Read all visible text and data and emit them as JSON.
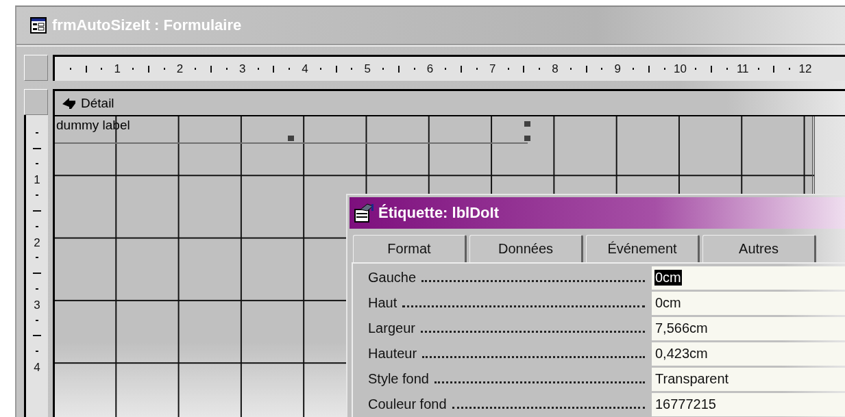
{
  "window": {
    "title": "frmAutoSizeIt : Formulaire"
  },
  "ruler_horizontal": [
    "1",
    "2",
    "3",
    "4",
    "5",
    "6",
    "7",
    "8",
    "9",
    "10",
    "11",
    "12"
  ],
  "ruler_vertical": [
    "1",
    "2",
    "3",
    "4"
  ],
  "section": {
    "title": "Détail"
  },
  "label_control": {
    "text": "dummy label",
    "selected": true
  },
  "property_sheet": {
    "title": "Étiquette: lblDoIt",
    "tabs": [
      {
        "label": "Format"
      },
      {
        "label": "Données"
      },
      {
        "label": "Événement"
      },
      {
        "label": "Autres"
      }
    ],
    "properties": [
      {
        "name": "Gauche",
        "value": "0cm",
        "selected": true
      },
      {
        "name": "Haut",
        "value": "0cm",
        "selected": false
      },
      {
        "name": "Largeur",
        "value": "7,566cm",
        "selected": false
      },
      {
        "name": "Hauteur",
        "value": "0,423cm",
        "selected": false
      },
      {
        "name": "Style fond",
        "value": "Transparent",
        "selected": false
      },
      {
        "name": "Couleur fond",
        "value": "16777215",
        "selected": false
      }
    ]
  }
}
